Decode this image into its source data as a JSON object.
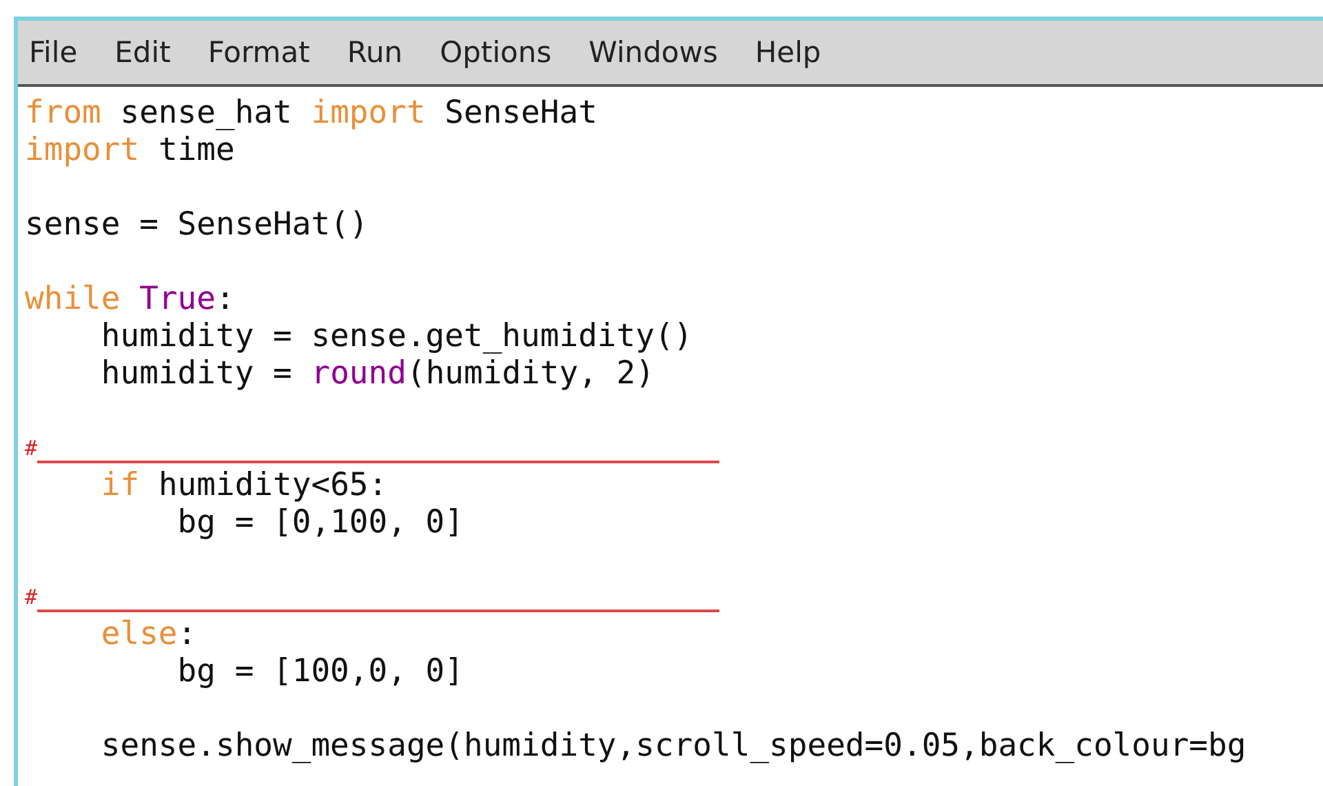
{
  "menu": [
    "File",
    "Edit",
    "Format",
    "Run",
    "Options",
    "Windows",
    "Help"
  ],
  "lines": [
    {
      "kind": "code",
      "tokens": [
        {
          "kind": "keyword",
          "text": "from"
        },
        {
          "kind": "plain",
          "text": " sense_hat "
        },
        {
          "kind": "keyword",
          "text": "import"
        },
        {
          "kind": "plain",
          "text": " SenseHat"
        }
      ]
    },
    {
      "kind": "code",
      "tokens": [
        {
          "kind": "keyword",
          "text": "import"
        },
        {
          "kind": "plain",
          "text": " time"
        }
      ]
    },
    {
      "kind": "empty"
    },
    {
      "kind": "code",
      "tokens": [
        {
          "kind": "plain",
          "text": "sense = SenseHat()"
        }
      ]
    },
    {
      "kind": "empty"
    },
    {
      "kind": "code",
      "tokens": [
        {
          "kind": "keyword",
          "text": "while"
        },
        {
          "kind": "builtin",
          "text": " True"
        },
        {
          "kind": "plain",
          "text": ":"
        }
      ]
    },
    {
      "kind": "code",
      "tokens": [
        {
          "kind": "plain",
          "text": "    humidity = sense.get_humidity()"
        }
      ]
    },
    {
      "kind": "code",
      "tokens": [
        {
          "kind": "plain",
          "text": "    humidity = "
        },
        {
          "kind": "builtin",
          "text": "round"
        },
        {
          "kind": "plain",
          "text": "(humidity, 2)"
        }
      ]
    },
    {
      "kind": "empty"
    },
    {
      "kind": "blank",
      "tokens": [
        {
          "kind": "comment",
          "text": "#"
        }
      ]
    },
    {
      "kind": "code",
      "tokens": [
        {
          "kind": "keyword",
          "text": "    if"
        },
        {
          "kind": "plain",
          "text": " humidity<65:"
        }
      ]
    },
    {
      "kind": "code",
      "tokens": [
        {
          "kind": "plain",
          "text": "        bg = [0,100, 0]"
        }
      ]
    },
    {
      "kind": "empty"
    },
    {
      "kind": "blank",
      "tokens": [
        {
          "kind": "comment",
          "text": "#"
        }
      ]
    },
    {
      "kind": "code",
      "tokens": [
        {
          "kind": "keyword",
          "text": "    else"
        },
        {
          "kind": "plain",
          "text": ":"
        }
      ]
    },
    {
      "kind": "code",
      "tokens": [
        {
          "kind": "plain",
          "text": "        bg = [100,0, 0]"
        }
      ]
    },
    {
      "kind": "empty"
    },
    {
      "kind": "code",
      "tokens": [
        {
          "kind": "plain",
          "text": "    sense.show_message(humidity,scroll_speed=0.05,back_colour=bg"
        }
      ]
    }
  ]
}
